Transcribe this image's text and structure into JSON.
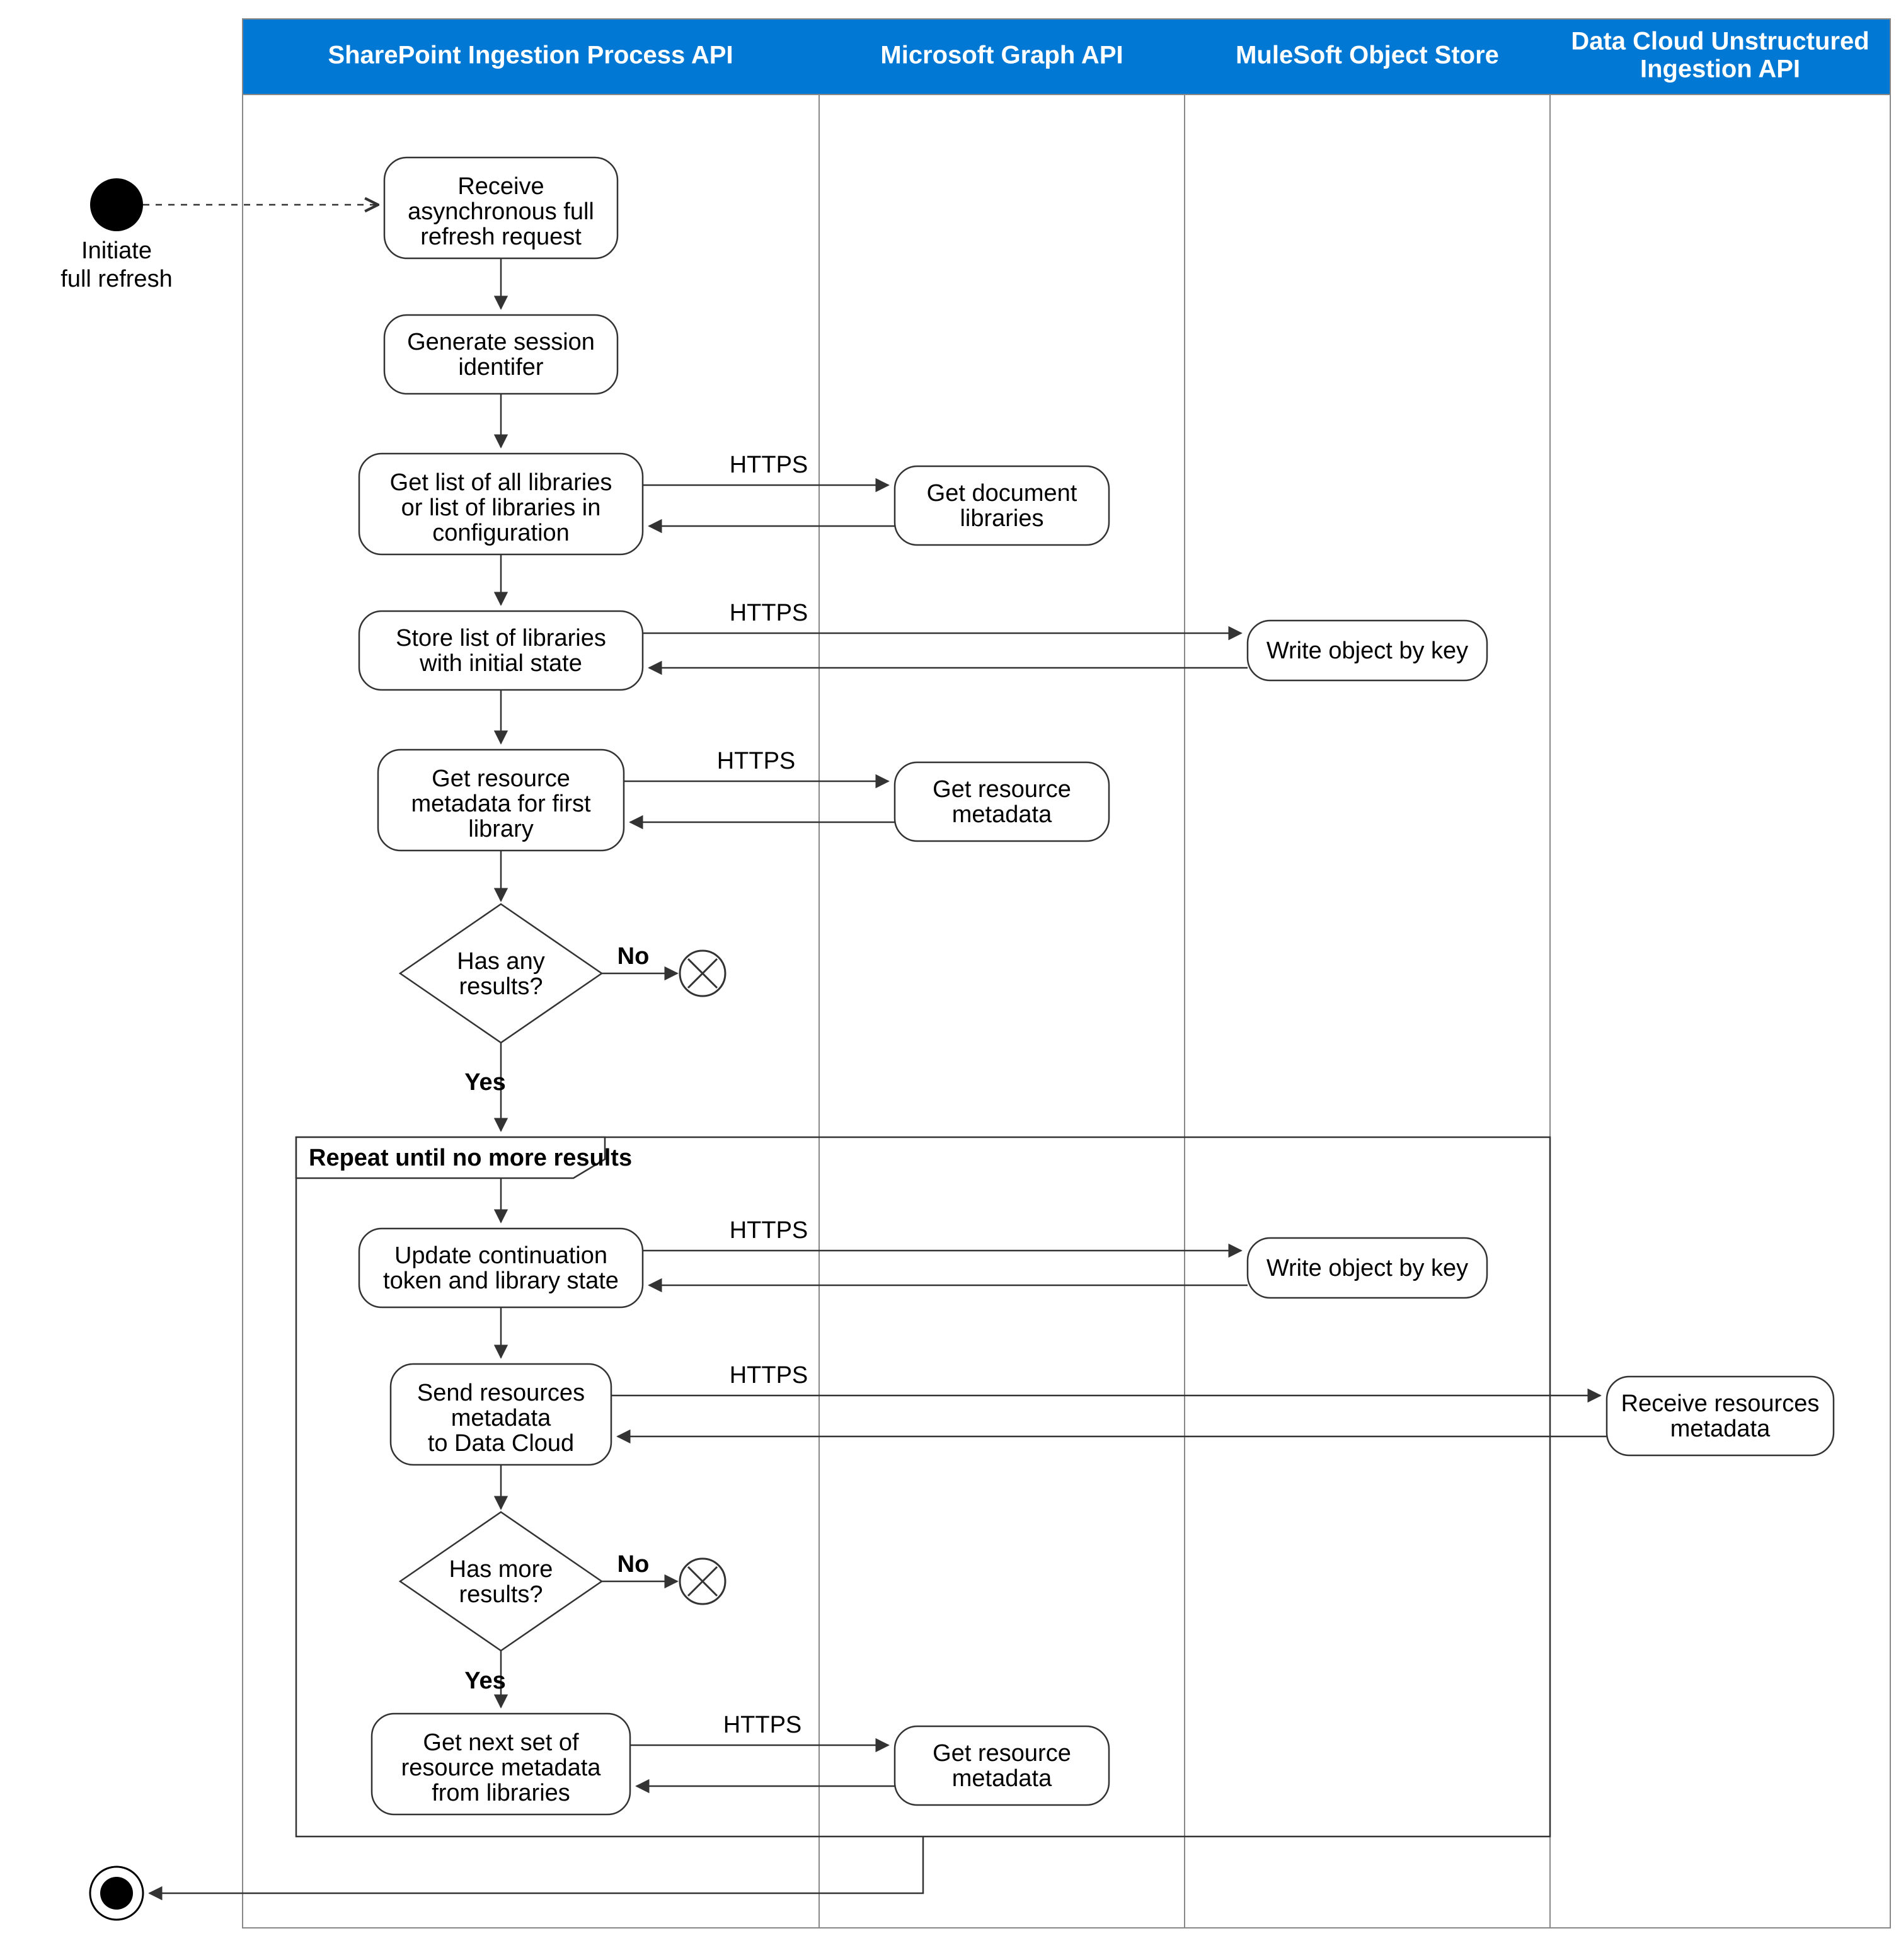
{
  "start_label_l1": "Initiate",
  "start_label_l2": "full refresh",
  "lanes": {
    "lane1": "SharePoint Ingestion Process API",
    "lane2": "Microsoft Graph API",
    "lane3": "MuleSoft Object Store",
    "lane4_l1": "Data Cloud Unstructured",
    "lane4_l2": "Ingestion API"
  },
  "nodes": {
    "receive_l1": "Receive",
    "receive_l2": "asynchronous full",
    "receive_l3": "refresh request",
    "gensession_l1": "Generate session",
    "gensession_l2": "identifer",
    "getlibs_l1": "Get list of all libraries",
    "getlibs_l2": "or list of libraries in",
    "getlibs_l3": "configuration",
    "getdoclibs_l1": "Get document",
    "getdoclibs_l2": "libraries",
    "storelist_l1": "Store list of libraries",
    "storelist_l2": "with initial state",
    "writeobj1": "Write object by key",
    "getresmeta_l1": "Get resource",
    "getresmeta_l2": "metadata for first",
    "getresmeta_l3": "library",
    "graph_getres_l1": "Get resource",
    "graph_getres_l2": "metadata",
    "decision1_l1": "Has any",
    "decision1_l2": "results?",
    "loop_label": "Repeat until no more results",
    "upd_token_l1": "Update continuation",
    "upd_token_l2": "token and library state",
    "writeobj2": "Write object by key",
    "sendres_l1": "Send resources",
    "sendres_l2": "metadata",
    "sendres_l3": "to Data Cloud",
    "recvres_l1": "Receive resources",
    "recvres_l2": "metadata",
    "decision2_l1": "Has more",
    "decision2_l2": "results?",
    "getnext_l1": "Get next set of",
    "getnext_l2": "resource metadata",
    "getnext_l3": "from libraries",
    "graph_getres2_l1": "Get resource",
    "graph_getres2_l2": "metadata"
  },
  "labels": {
    "https": "HTTPS",
    "yes": "Yes",
    "no": "No"
  }
}
